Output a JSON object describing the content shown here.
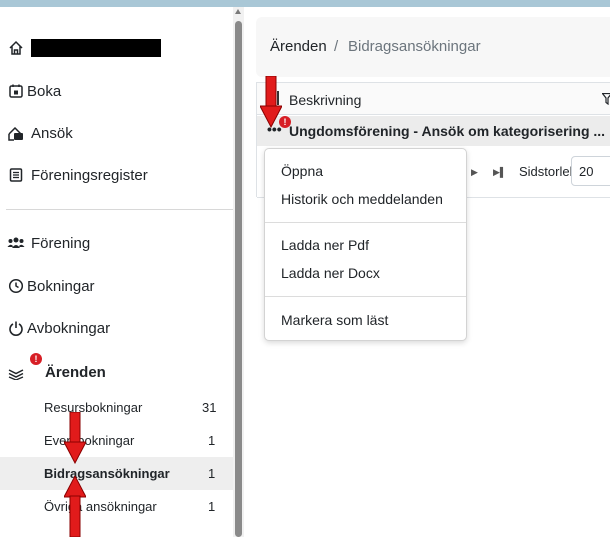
{
  "sidebar": {
    "items": [
      {
        "label": "Boka",
        "icon": "calendar-icon"
      },
      {
        "label": "Ansök",
        "icon": "application-icon"
      },
      {
        "label": "Föreningsregister",
        "icon": "register-icon"
      }
    ],
    "items2": [
      {
        "label": "Förening",
        "icon": "users-icon"
      },
      {
        "label": "Bokningar",
        "icon": "clock-icon"
      },
      {
        "label": "Avbokningar",
        "icon": "power-icon"
      }
    ],
    "section": {
      "label": "Ärenden",
      "badge": "!"
    },
    "sub_items": [
      {
        "label": "Resursbokningar",
        "count": "31"
      },
      {
        "label": "Eventbokningar",
        "count": "1"
      },
      {
        "label": "Bidragsansökningar",
        "count": "1"
      },
      {
        "label": "Övriga ansökningar",
        "count": "1"
      }
    ]
  },
  "breadcrumb": {
    "first": "Ärenden",
    "separator": "/",
    "current": "Bidragsansökningar"
  },
  "grid": {
    "column": "Beskrivning",
    "row": {
      "text": "Ungdomsförening - Ansök om kategorisering ...",
      "menu": "•••",
      "badge": "!"
    },
    "pager": {
      "size_label": "Sidstorlek",
      "size_value": "20"
    }
  },
  "menu": {
    "items": [
      "Öppna",
      "Historik och meddelanden",
      "Ladda ner Pdf",
      "Ladda ner Docx",
      "Markera som läst"
    ]
  },
  "colors": {
    "accent_bar": "#a9c7d6",
    "badge": "#d71f26",
    "arrow": "#e11b1b"
  }
}
